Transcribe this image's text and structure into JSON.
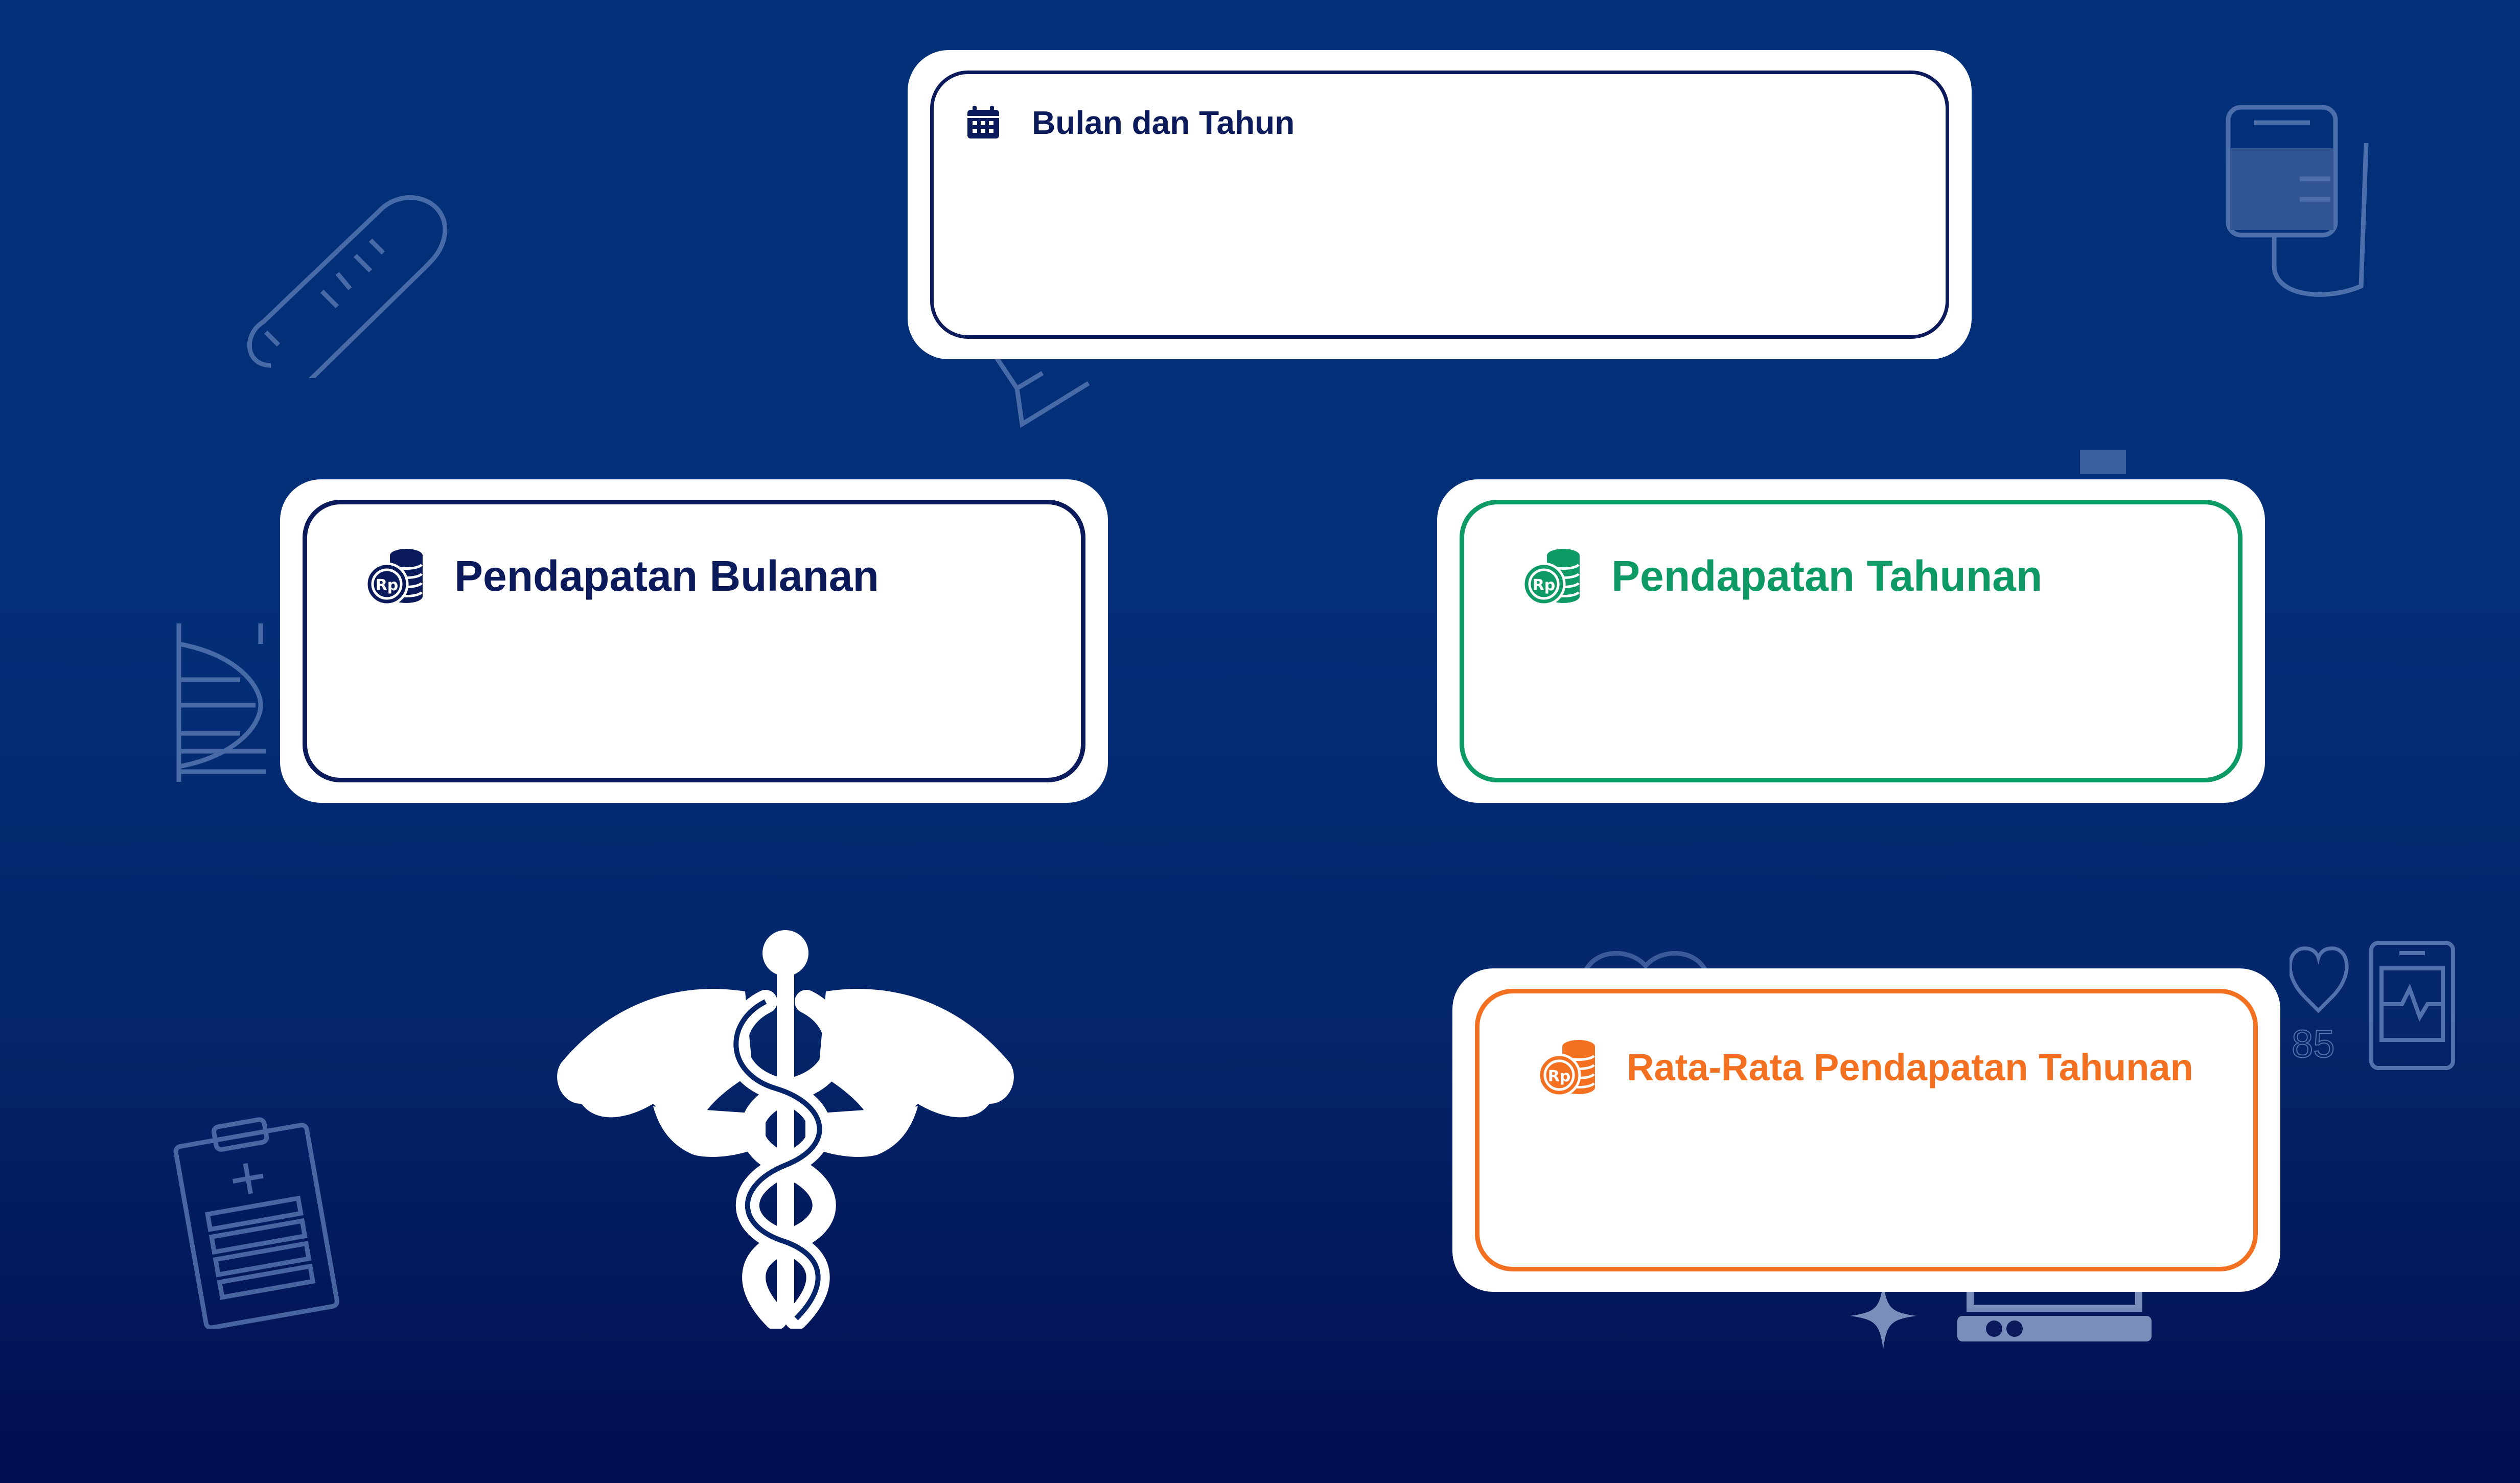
{
  "colors": {
    "background_top": "#023179",
    "background_bottom": "#020e50",
    "navy": "#0b1a5a",
    "green": "#0e9a64",
    "orange": "#f37021",
    "card": "#ffffff"
  },
  "cards": {
    "date": {
      "title": "Bulan dan Tahun",
      "icon": "calendar-icon",
      "value": ""
    },
    "monthly_income": {
      "title": "Pendapatan Bulanan",
      "icon": "rupiah-coins-icon",
      "value": ""
    },
    "yearly_income": {
      "title": "Pendapatan Tahunan",
      "icon": "rupiah-coins-icon",
      "value": ""
    },
    "avg_yearly_income": {
      "title": "Rata-Rata Pendapatan Tahunan",
      "icon": "rupiah-coins-icon",
      "value": ""
    }
  },
  "decorations": {
    "heart_rate_value": "85",
    "icons": [
      "thermometer-icon",
      "iv-bag-icon",
      "dna-icon",
      "clipboard-icon",
      "caduceus-icon",
      "heart-monitor-icon",
      "sparkle-icon",
      "equipment-icon"
    ]
  }
}
